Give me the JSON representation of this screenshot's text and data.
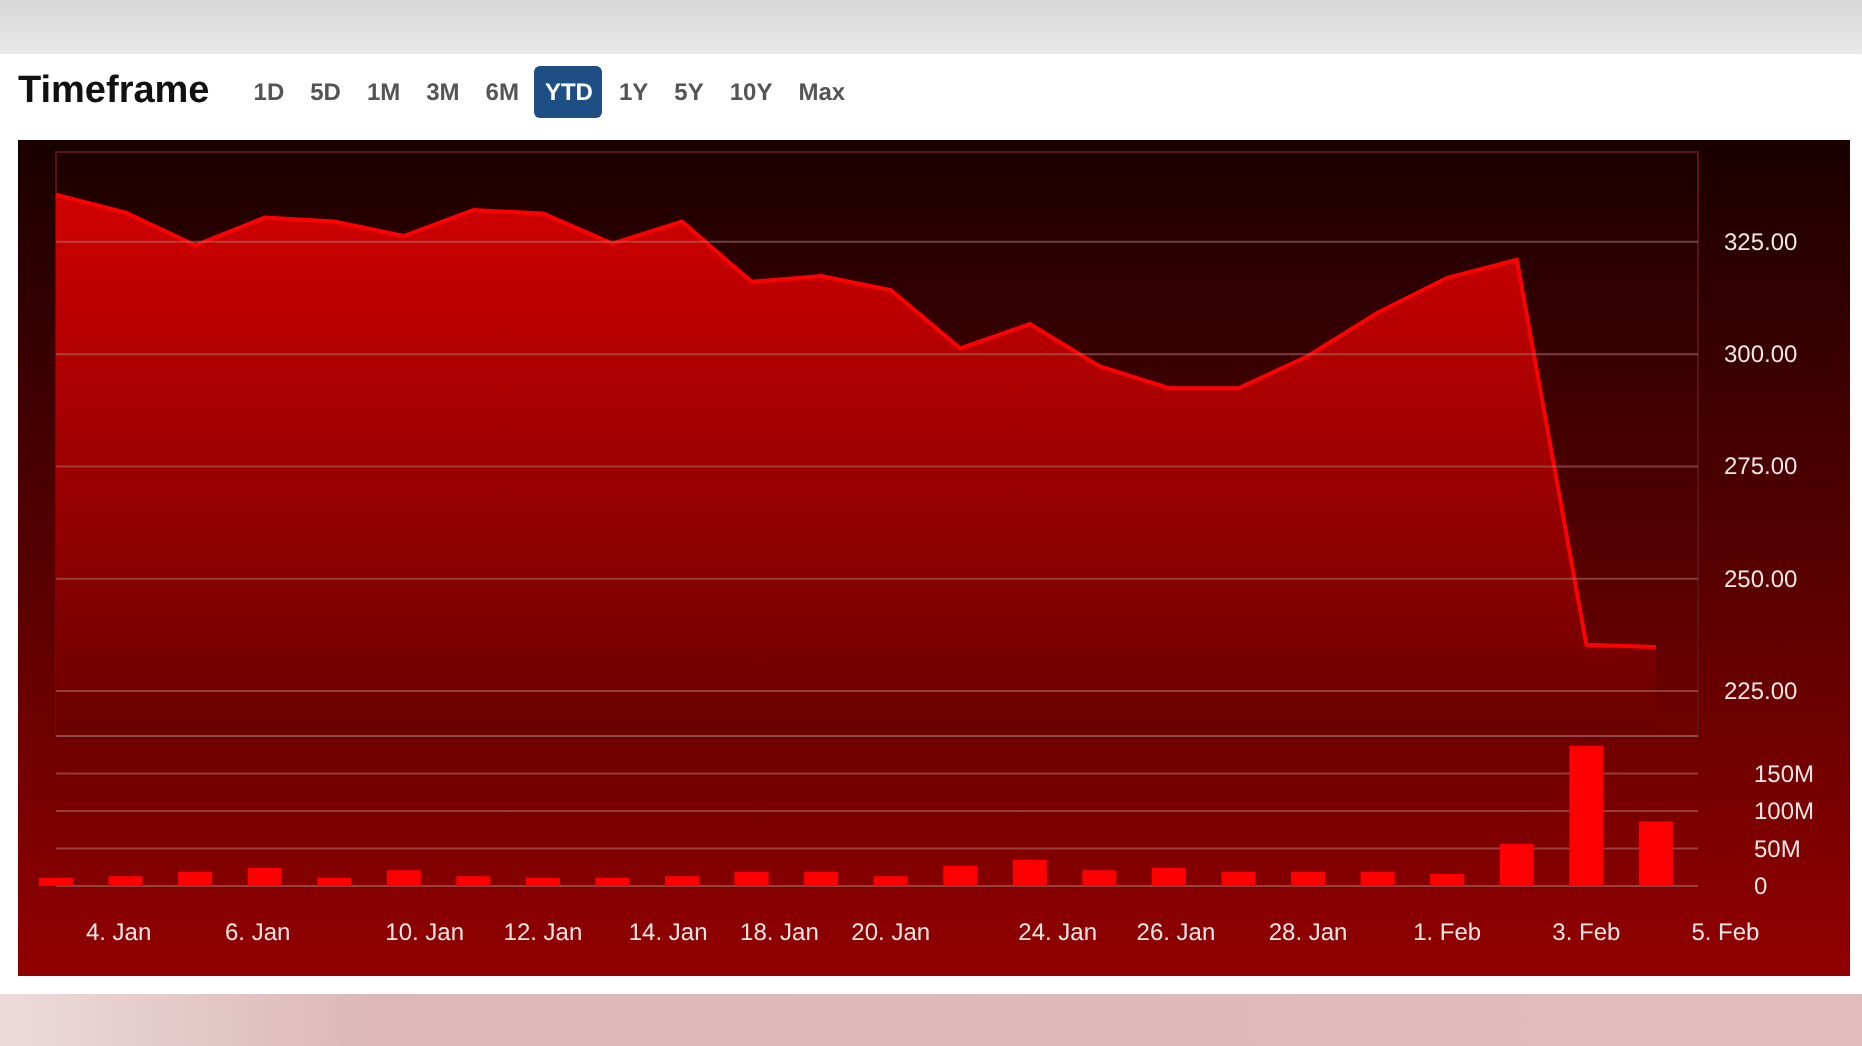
{
  "header": {
    "title": "Timeframe"
  },
  "ranges": [
    {
      "label": "1D",
      "selected": false
    },
    {
      "label": "5D",
      "selected": false
    },
    {
      "label": "1M",
      "selected": false
    },
    {
      "label": "3M",
      "selected": false
    },
    {
      "label": "6M",
      "selected": false
    },
    {
      "label": "YTD",
      "selected": true
    },
    {
      "label": "1Y",
      "selected": false
    },
    {
      "label": "5Y",
      "selected": false
    },
    {
      "label": "10Y",
      "selected": false
    },
    {
      "label": "Max",
      "selected": false
    }
  ],
  "price_chart": {
    "chart_data": {
      "type": "area",
      "grid": true,
      "ylim": [
        215,
        345
      ],
      "yticks": [
        {
          "value": 225,
          "label": "225.00"
        },
        {
          "value": 250,
          "label": "250.00"
        },
        {
          "value": 275,
          "label": "275.00"
        },
        {
          "value": 300,
          "label": "300.00"
        },
        {
          "value": 325,
          "label": "325.00"
        }
      ],
      "series": [
        {
          "color": "#ff0000",
          "values": [
            335.5,
            331.5,
            324.2,
            330.4,
            329.5,
            326.3,
            332.1,
            331.3,
            324.6,
            329.5,
            316.1,
            317.4,
            314.3,
            301.3,
            306.7,
            297.3,
            292.4,
            292.4,
            299.6,
            309.2,
            317.0,
            321.0,
            235.3,
            234.8
          ]
        }
      ]
    }
  },
  "volume_chart": {
    "date_labels": [
      "4. Jan",
      "6. Jan",
      "10. Jan",
      "12. Jan",
      "14. Jan",
      "18. Jan",
      "20. Jan",
      "24. Jan",
      "26. Jan",
      "28. Jan",
      "1. Feb",
      "3. Feb",
      "5. Feb"
    ],
    "chart_data": {
      "type": "bar",
      "grid": true,
      "ylim": [
        0,
        200
      ],
      "yticks": [
        {
          "value": 0,
          "label": "0"
        },
        {
          "value": 50,
          "label": "50M"
        },
        {
          "value": 100,
          "label": "100M"
        },
        {
          "value": 150,
          "label": "150M"
        }
      ],
      "series": [
        {
          "color": "#ff0000",
          "values": [
            11,
            13,
            19,
            24,
            11,
            21,
            13,
            11,
            11,
            13,
            19,
            19,
            13,
            27,
            35,
            21,
            24,
            19,
            19,
            19,
            16,
            56,
            187,
            86
          ]
        }
      ]
    }
  }
}
